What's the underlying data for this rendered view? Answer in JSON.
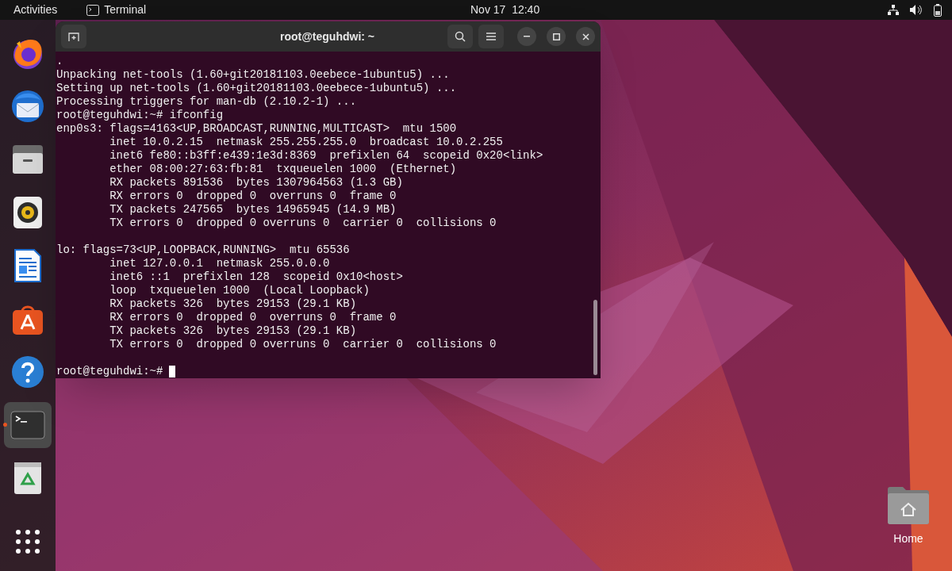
{
  "top_bar": {
    "activities": "Activities",
    "app_name": "Terminal",
    "clock": "Nov 17  12:40"
  },
  "dock": {
    "items": [
      {
        "kind": "firefox",
        "running": false,
        "selected": false
      },
      {
        "kind": "thunderbird",
        "running": false,
        "selected": false
      },
      {
        "kind": "files",
        "running": false,
        "selected": false
      },
      {
        "kind": "rhythmbox",
        "running": false,
        "selected": false
      },
      {
        "kind": "writer",
        "running": false,
        "selected": false
      },
      {
        "kind": "software",
        "running": false,
        "selected": false
      },
      {
        "kind": "help",
        "running": false,
        "selected": false
      },
      {
        "kind": "terminal",
        "running": true,
        "selected": true
      },
      {
        "kind": "trash",
        "running": false,
        "selected": false
      }
    ]
  },
  "window": {
    "title": "root@teguhdwi: ~",
    "blocks": [
      [
        ".",
        "Unpacking net-tools (1.60+git20181103.0eebece-1ubuntu5) ...",
        "Setting up net-tools (1.60+git20181103.0eebece-1ubuntu5) ...",
        "Processing triggers for man-db (2.10.2-1) ...",
        "root@teguhdwi:~# ifconfig",
        "enp0s3: flags=4163<UP,BROADCAST,RUNNING,MULTICAST>  mtu 1500",
        "        inet 10.0.2.15  netmask 255.255.255.0  broadcast 10.0.2.255",
        "        inet6 fe80::b3ff:e439:1e3d:8369  prefixlen 64  scopeid 0x20<link>",
        "        ether 08:00:27:63:fb:81  txqueuelen 1000  (Ethernet)",
        "        RX packets 891536  bytes 1307964563 (1.3 GB)",
        "        RX errors 0  dropped 0  overruns 0  frame 0",
        "        TX packets 247565  bytes 14965945 (14.9 MB)",
        "        TX errors 0  dropped 0 overruns 0  carrier 0  collisions 0"
      ],
      [
        "lo: flags=73<UP,LOOPBACK,RUNNING>  mtu 65536",
        "        inet 127.0.0.1  netmask 255.0.0.0",
        "        inet6 ::1  prefixlen 128  scopeid 0x10<host>",
        "        loop  txqueuelen 1000  (Local Loopback)",
        "        RX packets 326  bytes 29153 (29.1 KB)",
        "        RX errors 0  dropped 0  overruns 0  frame 0",
        "        TX packets 326  bytes 29153 (29.1 KB)",
        "        TX errors 0  dropped 0 overruns 0  carrier 0  collisions 0"
      ]
    ],
    "prompt": "root@teguhdwi:~#",
    "cursor": true
  },
  "desktop_icons": [
    {
      "label": "Home"
    }
  ]
}
